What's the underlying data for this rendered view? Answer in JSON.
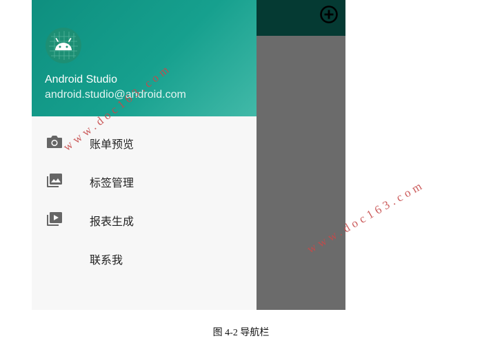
{
  "appbar": {
    "action_icon": "add-circle-icon",
    "background": "#053a33"
  },
  "drawer": {
    "header": {
      "user_name": "Android Studio",
      "user_email": "android.studio@android.com",
      "avatar_icon": "android-icon"
    },
    "items": [
      {
        "label": "账单预览",
        "icon": "camera-icon"
      },
      {
        "label": "标签管理",
        "icon": "gallery-icon"
      },
      {
        "label": "报表生成",
        "icon": "video-library-icon"
      },
      {
        "label": "联系我",
        "icon": ""
      }
    ]
  },
  "caption": "图 4-2 导航栏",
  "watermark": "www.doc163.com",
  "colors": {
    "accent": "#16a08e",
    "scrim": "#6b6b6b",
    "watermark": "#c64a4a"
  }
}
